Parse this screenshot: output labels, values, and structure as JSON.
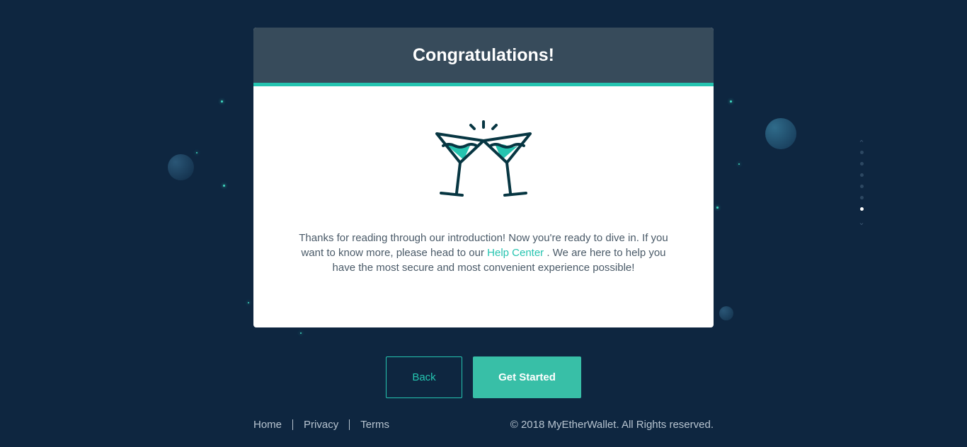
{
  "modal": {
    "title": "Congratulations!",
    "text_before": "Thanks for reading through our introduction! Now you're ready to dive in. If you want to know more, please head to our",
    "link_text": "Help Center",
    "text_after": ". We are here to help you have the most secure and most convenient experience possible!",
    "icon": "cheers-icon"
  },
  "buttons": {
    "back": "Back",
    "get_started": "Get Started"
  },
  "pager": {
    "total_pages": 6,
    "active_index": 5
  },
  "footer": {
    "links": [
      "Home",
      "Privacy",
      "Terms"
    ],
    "copyright": "© 2018 MyEtherWallet. All Rights reserved."
  },
  "colors": {
    "background": "#0e2640",
    "accent": "#25c4b0",
    "header": "#374b5b",
    "primary_button": "#38bfa7"
  }
}
